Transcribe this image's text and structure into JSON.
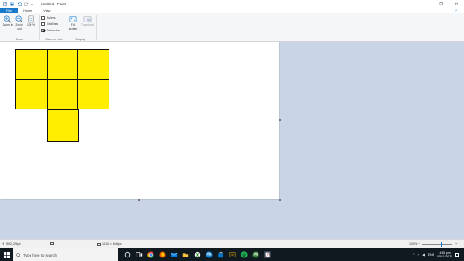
{
  "window": {
    "title": "Untitled - Paint",
    "controls": {
      "minimize": "–",
      "maximize": "❐",
      "close": "✕"
    }
  },
  "ribbon_tabs": [
    "File",
    "Home",
    "View"
  ],
  "ribbon": {
    "zoom_group": {
      "label": "Zoom",
      "zoom_in": "Zoom in",
      "zoom_out": "Zoom out",
      "percent": "100 %"
    },
    "show_hide_group": {
      "label": "Show or hide",
      "rulers": {
        "label": "Rulers",
        "checked": false
      },
      "gridlines": {
        "label": "Gridlines",
        "checked": false
      },
      "status_bar": {
        "label": "Status bar",
        "checked": true
      }
    },
    "display_group": {
      "label": "Display",
      "full_screen": "Full screen",
      "thumbnail": "Thumbnail"
    }
  },
  "status": {
    "cursor_pos": "502, 29px",
    "canvas_size": "1152 × 648px",
    "zoom": "100%"
  },
  "taskbar": {
    "search_placeholder": "Type here to search",
    "tray_lang": "ENG",
    "time": "4:35 pm",
    "date": "05/11/2020"
  },
  "colors": {
    "accent": "#1979ca",
    "square_fill": "#ffee00",
    "square_border": "#111111",
    "workspace": "#c9d5e6"
  },
  "icons": {
    "save": "save-icon",
    "undo": "undo-icon",
    "redo": "redo-icon",
    "zoom_in": "zoom-in-icon",
    "zoom_out": "zoom-out-icon",
    "full_screen": "full-screen-icon",
    "thumbnail": "thumbnail-icon",
    "search": "search-icon",
    "start": "windows-start-icon"
  }
}
